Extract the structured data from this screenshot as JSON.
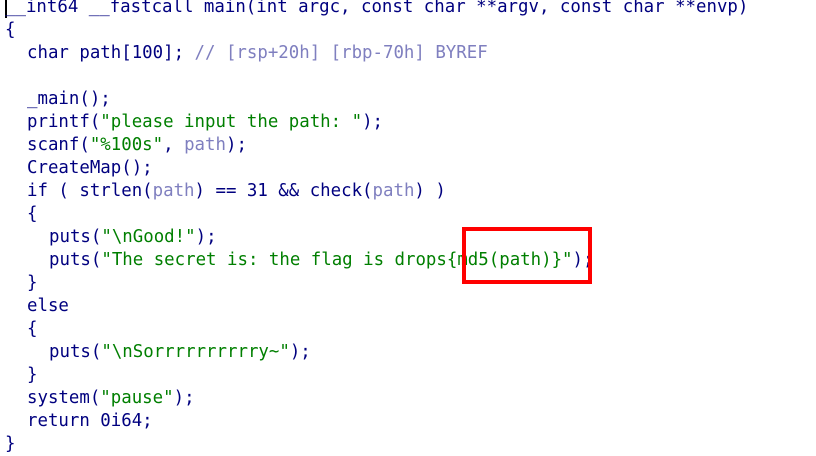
{
  "code": {
    "signature": "__int64 __fastcall main(int argc, const char **argv, const char **envp)",
    "open_brace": "{",
    "decl_type": "char path[100]; ",
    "decl_comment": "// [rsp+20h] [rbp-70h] BYREF",
    "call_main": "_main();",
    "printf_fn": "printf(",
    "printf_str": "\"please input the path: \"",
    "printf_end": ");",
    "scanf_fn": "scanf(",
    "scanf_str": "\"%100s\"",
    "scanf_sep": ", ",
    "scanf_var": "path",
    "scanf_end": ");",
    "createmap": "CreateMap();",
    "if_start": "if ( strlen(",
    "if_var1": "path",
    "if_mid": ") == 31 && check(",
    "if_var2": "path",
    "if_end": ") )",
    "brace_open_1": "{",
    "puts_good_fn": "puts(",
    "puts_good_str": "\"\\nGood!\"",
    "puts_good_end": ");",
    "puts_secret_fn": "puts(",
    "puts_secret_str": "\"The secret is: the flag is drops{md5(path)}\"",
    "puts_secret_end": ");",
    "brace_close_1": "}",
    "else_kw": "else",
    "brace_open_2": "{",
    "puts_sorry_fn": "puts(",
    "puts_sorry_str": "\"\\nSorrrrrrrrrry~\"",
    "puts_sorry_end": ");",
    "brace_close_2": "}",
    "system_fn": "system(",
    "system_str": "\"pause\"",
    "system_end": ");",
    "return_stmt": "return 0i64;",
    "close_brace": "}"
  },
  "colors": {
    "keyword": "#00007f",
    "string": "#007f00",
    "variable": "#7f7fbf",
    "highlight_box": "#ff0000"
  }
}
